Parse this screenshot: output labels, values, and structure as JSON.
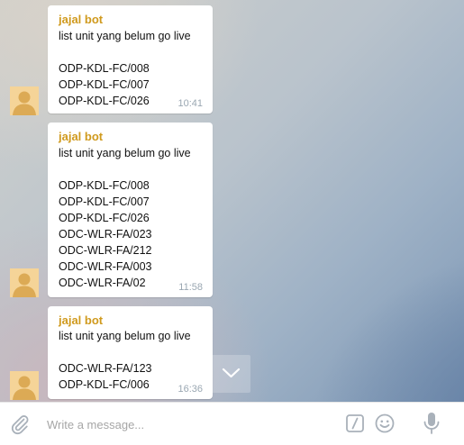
{
  "messages": [
    {
      "sender": "jajal bot",
      "lines": [
        "list unit yang belum go live",
        "",
        "ODP-KDL-FC/008",
        "ODP-KDL-FC/007",
        "ODP-KDL-FC/026"
      ],
      "time": "10:41"
    },
    {
      "sender": "jajal bot",
      "lines": [
        "list unit yang belum go live",
        "",
        "ODP-KDL-FC/008",
        "ODP-KDL-FC/007",
        "ODP-KDL-FC/026",
        "ODC-WLR-FA/023",
        "ODC-WLR-FA/212",
        "ODC-WLR-FA/003",
        "ODC-WLR-FA/02"
      ],
      "time": "11:58"
    },
    {
      "sender": "jajal bot",
      "lines": [
        "list unit yang belum go live",
        "",
        "ODC-WLR-FA/123",
        "ODP-KDL-FC/006"
      ],
      "time": "16:36"
    }
  ],
  "composer": {
    "placeholder": "Write a message...",
    "icons": [
      "paperclip-icon",
      "bot-command-icon",
      "emoji-icon",
      "microphone-icon"
    ]
  },
  "scroll_down_icon": "chevron-down-icon",
  "colors": {
    "sender": "#d09a1e",
    "time": "#9aa7b2",
    "avatar": "#f5d498",
    "icon": "#a9b1ba"
  }
}
